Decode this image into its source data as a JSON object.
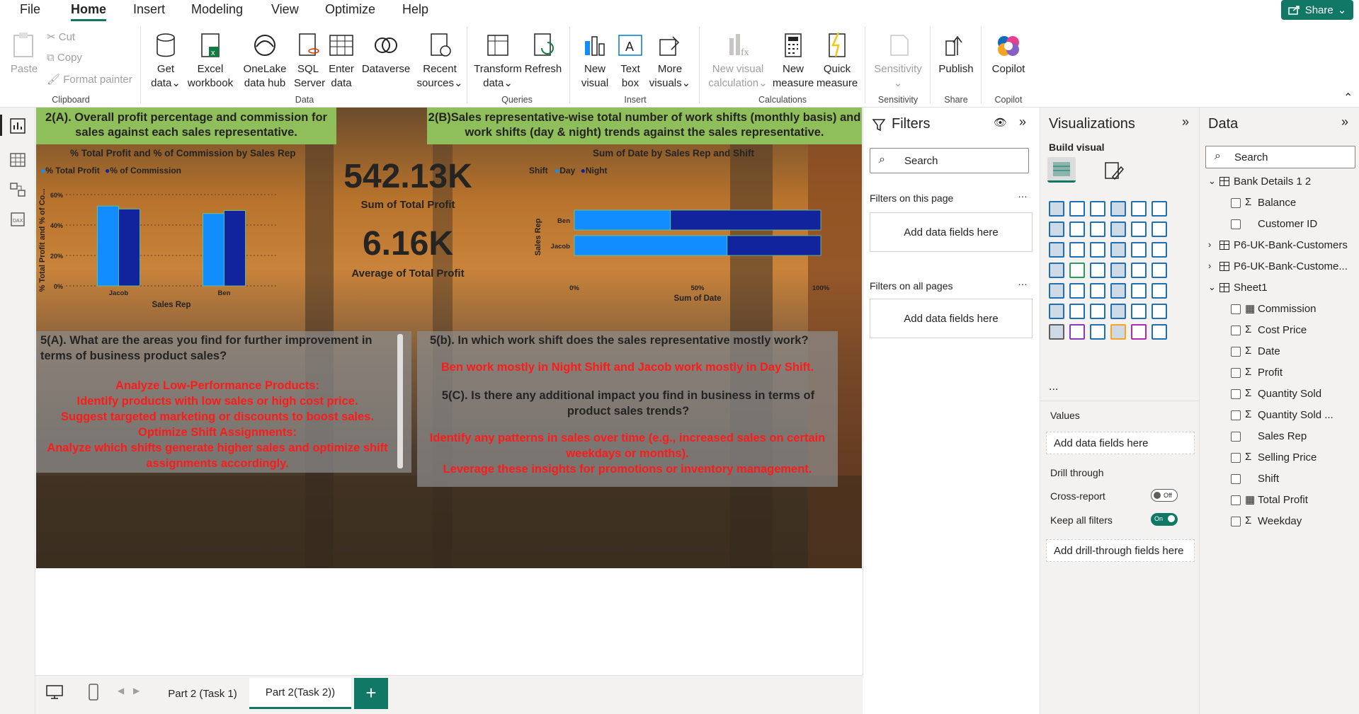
{
  "menu": {
    "items": [
      "File",
      "Home",
      "Insert",
      "Modeling",
      "View",
      "Optimize",
      "Help"
    ],
    "share": "Share"
  },
  "ribbon": {
    "paste": "Paste",
    "cut": "Cut",
    "copy": "Copy",
    "format_painter": "Format painter",
    "get_data": [
      "Get",
      "data"
    ],
    "excel": [
      "Excel",
      "workbook"
    ],
    "onelake": [
      "OneLake",
      "data hub"
    ],
    "sql": [
      "SQL",
      "Server"
    ],
    "enter_data": [
      "Enter",
      "data"
    ],
    "dataverse": "Dataverse",
    "recent": [
      "Recent",
      "sources"
    ],
    "transform": [
      "Transform",
      "data"
    ],
    "refresh": "Refresh",
    "new_visual": [
      "New",
      "visual"
    ],
    "text_box": [
      "Text",
      "box"
    ],
    "more_visuals": [
      "More",
      "visuals"
    ],
    "new_calc": [
      "New visual",
      "calculation"
    ],
    "new_measure": [
      "New",
      "measure"
    ],
    "quick_measure": [
      "Quick",
      "measure"
    ],
    "sensitivity": "Sensitivity",
    "publish": "Publish",
    "copilot": "Copilot",
    "groups": {
      "clipboard": "Clipboard",
      "data": "Data",
      "queries": "Queries",
      "insert": "Insert",
      "calculations": "Calculations",
      "sensitivity": "Sensitivity",
      "share": "Share",
      "copilot": "Copilot"
    }
  },
  "report": {
    "header_a": "2(A). Overall profit percentage and commission for sales against each sales representative.",
    "header_b": "2(B)Sales representative-wise total number of work shifts (monthly basis) and work shifts (day & night) trends against the sales representative.",
    "kpi1_value": "542.13K",
    "kpi1_label": "Sum of Total Profit",
    "kpi2_value": "6.16K",
    "kpi2_label": "Average of Total Profit",
    "q5a": "5(A). What are the areas you find for further improvement in terms of business product sales?",
    "a5a": [
      "Analyze Low-Performance Products:",
      "Identify products with low sales or high cost price.",
      "Suggest targeted marketing or discounts to boost sales.",
      "Optimize Shift Assignments:",
      "Analyze which shifts generate higher sales and optimize shift",
      "assignments accordingly."
    ],
    "q5b": "5(b). In which work shift does the sales representative mostly work?",
    "a5b": "Ben work mostly in Night Shift and Jacob work mostly in Day Shift.",
    "q5c": "5(C). Is there any additional impact you find in business in terms of product sales trends?",
    "a5c": [
      "Identify any patterns in sales over time (e.g., increased sales on certain",
      "weekdays or months).",
      "Leverage these insights for promotions or inventory management."
    ]
  },
  "chart_data": [
    {
      "type": "bar",
      "title": "% Total Profit and % of Commission by Sales Rep",
      "xlabel": "Sales Rep",
      "ylabel": "% Total Profit and % of Co...",
      "categories": [
        "Jacob",
        "Ben"
      ],
      "series": [
        {
          "name": "% Total Profit",
          "color": "#118dff",
          "values": [
            52.5,
            47.5
          ]
        },
        {
          "name": "% of Commission",
          "color": "#12239e",
          "values": [
            50.5,
            49.5
          ]
        }
      ],
      "yticks": [
        "0%",
        "20%",
        "40%",
        "60%"
      ],
      "ylim": [
        0,
        60
      ],
      "legend": "top-left",
      "grid": true
    },
    {
      "type": "bar",
      "orientation": "horizontal-stacked-100",
      "title": "Sum of Date by Sales Rep and Shift",
      "xlabel": "Sum of Date",
      "ylabel": "Sales Rep",
      "legend_title": "Shift",
      "categories": [
        "Ben",
        "Jacob"
      ],
      "series": [
        {
          "name": "Day",
          "color": "#118dff",
          "values": [
            39,
            62
          ]
        },
        {
          "name": "Night",
          "color": "#12239e",
          "values": [
            61,
            38
          ]
        }
      ],
      "xticks": [
        "0%",
        "50%",
        "100%"
      ],
      "xlim": [
        0,
        100
      ],
      "legend": "top-left"
    }
  ],
  "filters": {
    "title": "Filters",
    "search": "Search",
    "on_page": "Filters on this page",
    "all_pages": "Filters on all pages",
    "add": "Add data fields here"
  },
  "viz": {
    "title": "Visualizations",
    "build": "Build visual",
    "values": "Values",
    "add_values": "Add data fields here",
    "drill": "Drill through",
    "cross": "Cross-report",
    "cross_state": "Off",
    "keep": "Keep all filters",
    "keep_state": "On",
    "add_drill": "Add drill-through fields here",
    "more": "..."
  },
  "data": {
    "title": "Data",
    "search": "Search",
    "tables": [
      {
        "name": "Bank Details 1 2",
        "expanded": true,
        "fields": [
          {
            "n": "Balance",
            "s": true
          },
          {
            "n": "Customer ID",
            "s": false
          }
        ]
      },
      {
        "name": "P6-UK-Bank-Customers",
        "expanded": false,
        "fields": []
      },
      {
        "name": "P6-UK-Bank-Custome...",
        "expanded": false,
        "fields": []
      },
      {
        "name": "Sheet1",
        "expanded": true,
        "fields": [
          {
            "n": "Commission",
            "s": false,
            "calc": true
          },
          {
            "n": "Cost Price",
            "s": true
          },
          {
            "n": "Date",
            "s": true
          },
          {
            "n": "Profit",
            "s": true
          },
          {
            "n": "Quantity Sold",
            "s": true
          },
          {
            "n": "Quantity Sold ...",
            "s": true
          },
          {
            "n": "Sales Rep",
            "s": false
          },
          {
            "n": "Selling Price",
            "s": true
          },
          {
            "n": "Shift",
            "s": false
          },
          {
            "n": "Total Profit",
            "s": false,
            "calc": true
          },
          {
            "n": "Weekday",
            "s": true
          }
        ]
      }
    ]
  },
  "tabs": [
    "Part 2 (Task 1)",
    "Part 2(Task 2))"
  ]
}
